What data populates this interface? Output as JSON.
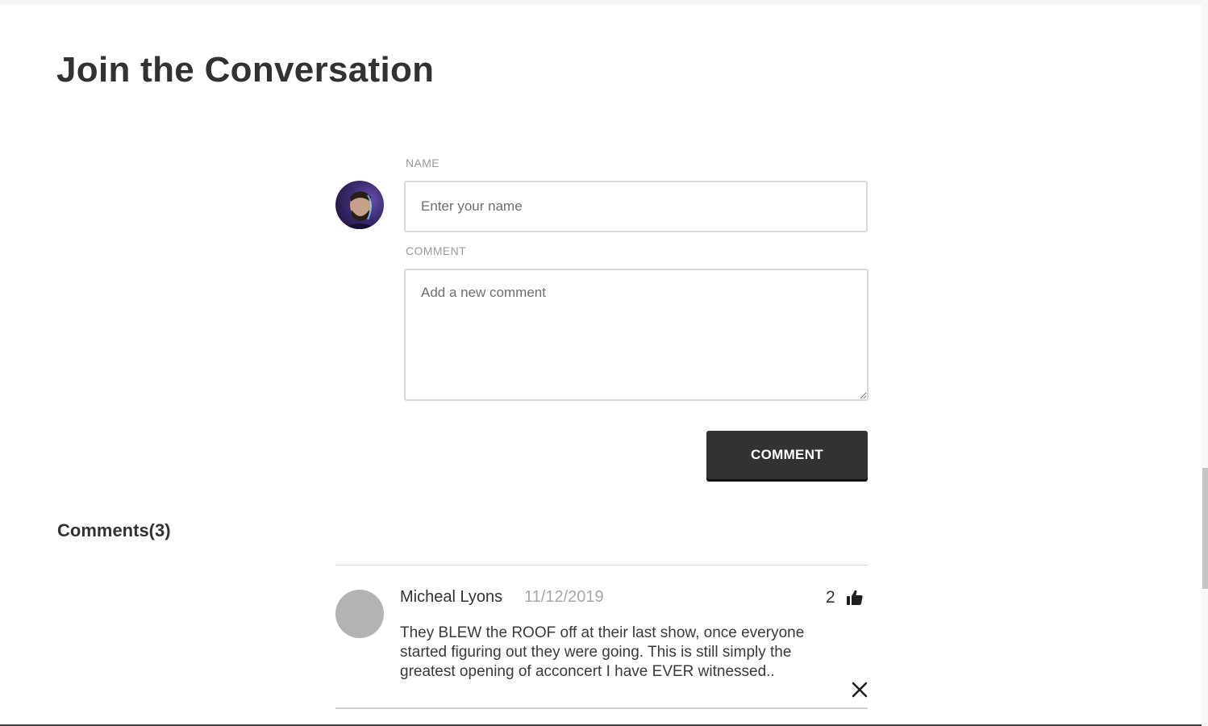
{
  "page": {
    "title": "Join the Conversation"
  },
  "form": {
    "avatar_icon": "user-avatar-photo",
    "name_label": "NAME",
    "name_placeholder": "Enter your name",
    "name_value": "",
    "comment_label": "COMMENT",
    "comment_placeholder": "Add a new comment",
    "comment_value": "",
    "submit_label": "COMMENT"
  },
  "comments": {
    "heading": "Comments(3)",
    "items": [
      {
        "author": "Micheal Lyons",
        "date": "11/12/2019",
        "likes": "2",
        "like_icon": "thumbs-up-icon",
        "delete_icon": "close-icon",
        "text": "They BLEW the ROOF off at their last show, once everyone started figuring out they were going. This is still simply the greatest opening of acconcert I have EVER witnessed.."
      }
    ]
  },
  "colors": {
    "text": "#323232",
    "muted": "#9a9a9a",
    "button_bg": "#323232",
    "button_text": "#ffffff",
    "border": "#d9d9d9",
    "placeholder_avatar": "#b3b3b3"
  }
}
